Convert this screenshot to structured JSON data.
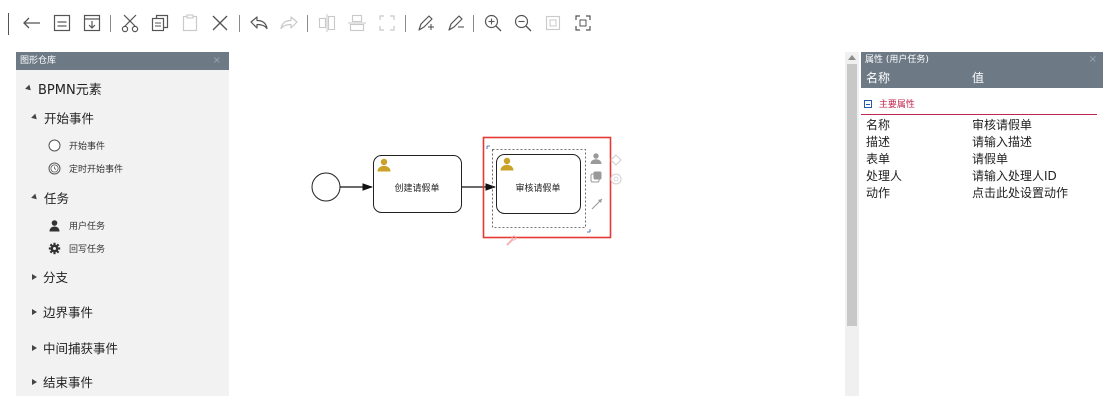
{
  "palette": {
    "title": "图形仓库",
    "close": "×",
    "root_label": "BPMN元素",
    "groups": [
      {
        "label": "开始事件",
        "expanded": true,
        "items": [
          "开始事件",
          "定时开始事件"
        ]
      },
      {
        "label": "任务",
        "expanded": true,
        "items": [
          "用户任务",
          "回写任务"
        ]
      },
      {
        "label": "分支",
        "expanded": false
      },
      {
        "label": "边界事件",
        "expanded": false
      },
      {
        "label": "中间捕获事件",
        "expanded": false
      },
      {
        "label": "结束事件",
        "expanded": false
      }
    ]
  },
  "canvas": {
    "task1_label": "创建请假单",
    "task2_label": "审核请假单"
  },
  "properties": {
    "title": "属性 (用户任务)",
    "close": "×",
    "col_name": "名称",
    "col_value": "值",
    "group_label": "主要属性",
    "rows": [
      {
        "key": "名称",
        "value": "审核请假单"
      },
      {
        "key": "描述",
        "value": "请输入描述"
      },
      {
        "key": "表单",
        "value": "请假单"
      },
      {
        "key": "处理人",
        "value": "请输入处理人ID"
      },
      {
        "key": "动作",
        "value": "点击此处设置动作"
      }
    ]
  },
  "colors": {
    "panel_header": "#6d7a86",
    "selection": "#e53935",
    "group_accent": "#c0264e",
    "user_icon": "#c9a227"
  }
}
